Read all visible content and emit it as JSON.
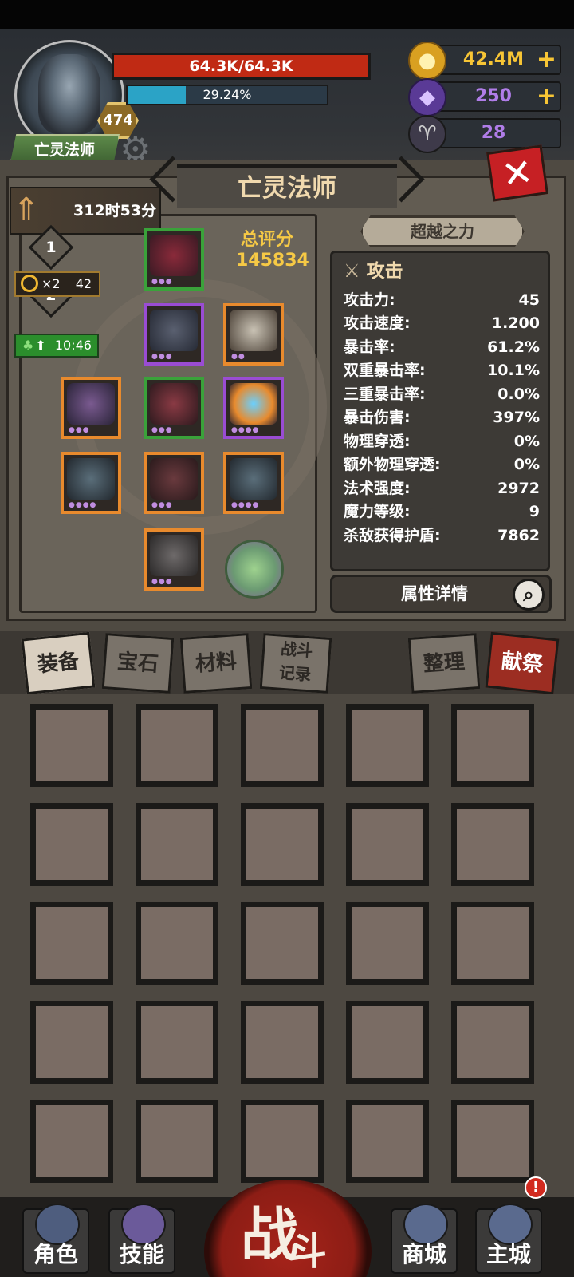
{
  "hero": {
    "name": "亡灵法师",
    "level": "474",
    "hp_text": "64.3K/64.3K",
    "hp_fraction": 1.0,
    "xp_text": "29.24%",
    "xp_fraction": 0.2924
  },
  "currencies": [
    {
      "name": "gold-coin-icon",
      "value": "42.4M",
      "has_plus": true,
      "color": "#f7c535"
    },
    {
      "name": "crystal-icon",
      "value": "250",
      "has_plus": true,
      "color": "#b07de8"
    },
    {
      "name": "ram-skull-icon",
      "value": "28",
      "has_plus": false,
      "color": "#b07de8"
    }
  ],
  "panel": {
    "title": "亡灵法师",
    "timer": "312时53分",
    "diamond_1": "1",
    "diamond_2": "2",
    "multiplier": "×2",
    "multiplier_count": "42",
    "clover_timer": "10:46"
  },
  "score": {
    "label": "总评分",
    "value": "145834"
  },
  "transcend_label": "超越之力",
  "stats": {
    "header": "攻击",
    "rows": [
      {
        "label": "攻击力:",
        "value": "45"
      },
      {
        "label": "攻击速度:",
        "value": "1.200"
      },
      {
        "label": "暴击率:",
        "value": "61.2%"
      },
      {
        "label": "双重暴击率:",
        "value": "10.1%"
      },
      {
        "label": "三重暴击率:",
        "value": "0.0%"
      },
      {
        "label": "暴击伤害:",
        "value": "397%"
      },
      {
        "label": "物理穿透:",
        "value": "0%"
      },
      {
        "label": "额外物理穿透:",
        "value": "0%"
      },
      {
        "label": "法术强度:",
        "value": "2972"
      },
      {
        "label": "魔力等级:",
        "value": "9"
      },
      {
        "label": "杀敌获得护盾:",
        "value": "7862"
      }
    ]
  },
  "detail_label": "属性详情",
  "tabs": {
    "equip": "装备",
    "gem": "宝石",
    "material": "材料",
    "battle_log_1": "战斗",
    "battle_log_2": "记录",
    "sort": "整理",
    "sacrifice": "献祭"
  },
  "nav": {
    "role": "角色",
    "skill": "技能",
    "battle_1": "战",
    "battle_2": "斗",
    "shop": "商城",
    "main_city": "主城",
    "alert": "!"
  },
  "colors": {
    "accent_gold": "#f6c945",
    "hp_red": "#c02a14",
    "xp_blue": "#2ba3c6",
    "rarity_green": "#3aa23a",
    "rarity_purple": "#9a4cd3",
    "rarity_orange": "#e88a2d"
  }
}
